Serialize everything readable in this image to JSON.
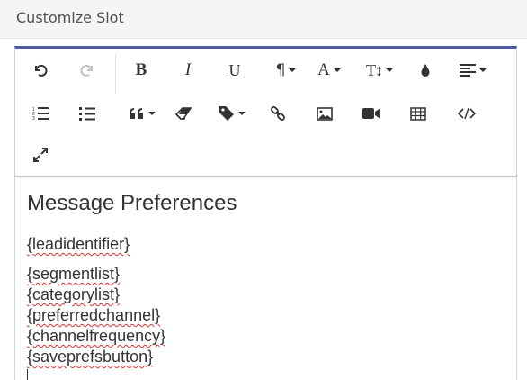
{
  "panel": {
    "title": "Customize Slot"
  },
  "toolbar": {
    "rows": [
      [
        {
          "name": "undo-icon",
          "label": "",
          "kind": "svg",
          "icon": "undo",
          "disabled": false
        },
        {
          "name": "redo-icon",
          "label": "",
          "kind": "svg",
          "icon": "redo",
          "disabled": true
        },
        {
          "name": "bold-button",
          "label": "B",
          "kind": "text",
          "cls": "txt-b"
        },
        {
          "name": "italic-button",
          "label": "I",
          "kind": "text",
          "cls": "txt-i"
        },
        {
          "name": "underline-button",
          "label": "U",
          "kind": "text",
          "cls": "txt-u"
        },
        {
          "name": "paragraph-dropdown",
          "label": "¶",
          "kind": "text",
          "cls": "txt-para",
          "caret": true
        },
        {
          "name": "font-color-dropdown",
          "label": "A",
          "kind": "text",
          "cls": "txt-A",
          "caret": true
        },
        {
          "name": "font-size-dropdown",
          "label": "T↕",
          "kind": "text",
          "cls": "txt-T",
          "caret": true
        },
        {
          "name": "color-drop-icon",
          "label": "",
          "kind": "svg",
          "icon": "drop"
        },
        {
          "name": "align-dropdown",
          "label": "",
          "kind": "svg",
          "icon": "align",
          "caret": true
        }
      ],
      [
        {
          "name": "ordered-list-icon",
          "label": "",
          "kind": "svg",
          "icon": "ol"
        },
        {
          "name": "unordered-list-icon",
          "label": "",
          "kind": "svg",
          "icon": "ul"
        },
        {
          "name": "quote-dropdown",
          "label": "",
          "kind": "svg",
          "icon": "quote",
          "caret": true
        },
        {
          "name": "eraser-icon",
          "label": "",
          "kind": "svg",
          "icon": "eraser"
        },
        {
          "name": "tag-dropdown",
          "label": "",
          "kind": "svg",
          "icon": "tag",
          "caret": true
        },
        {
          "name": "link-icon",
          "label": "",
          "kind": "svg",
          "icon": "link"
        },
        {
          "name": "image-icon",
          "label": "",
          "kind": "svg",
          "icon": "image"
        },
        {
          "name": "video-icon",
          "label": "",
          "kind": "svg",
          "icon": "video"
        },
        {
          "name": "table-icon",
          "label": "",
          "kind": "svg",
          "icon": "table"
        },
        {
          "name": "code-view-icon",
          "label": "",
          "kind": "svg",
          "icon": "code"
        }
      ],
      [
        {
          "name": "fullscreen-icon",
          "label": "",
          "kind": "svg",
          "icon": "expand"
        }
      ]
    ]
  },
  "content": {
    "heading": "Message Preferences",
    "tokens": [
      "{leadidentifier}",
      "{segmentlist}",
      "{categorylist}",
      "{preferredchannel}",
      "{channelfrequency}",
      "{saveprefsbutton}"
    ]
  },
  "colors": {
    "accent": "#4e5d9d",
    "spellcheck": "#e03030",
    "disabled": "#c2c2c2"
  }
}
